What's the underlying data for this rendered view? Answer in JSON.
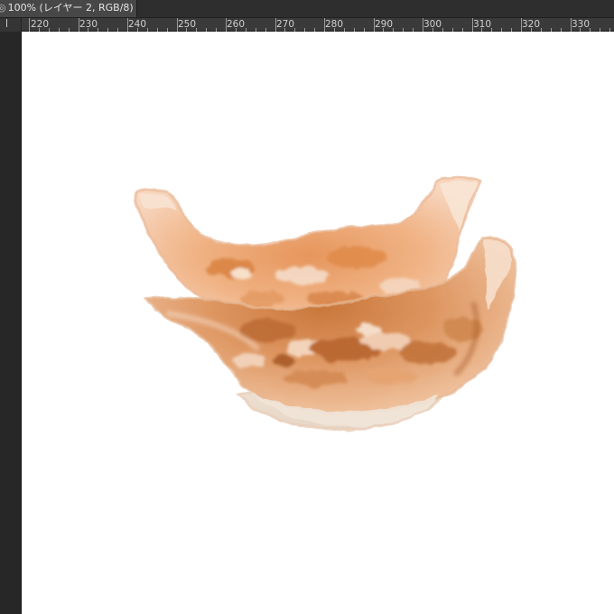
{
  "document_tab": {
    "title": "100% (レイヤー 2, RGB/8)",
    "lead_glyph": "◎"
  },
  "ruler": {
    "labels": [
      "220",
      "230",
      "240",
      "250",
      "260",
      "270",
      "280",
      "290",
      "300",
      "310",
      "320",
      "330"
    ]
  },
  "colors": {
    "canvas_background": "#ffffff",
    "workspace_background": "#282828",
    "ruler_background": "#3a3a3a",
    "tab_active": "#474747"
  },
  "artwork": {
    "subject": "dumpling-painting"
  }
}
